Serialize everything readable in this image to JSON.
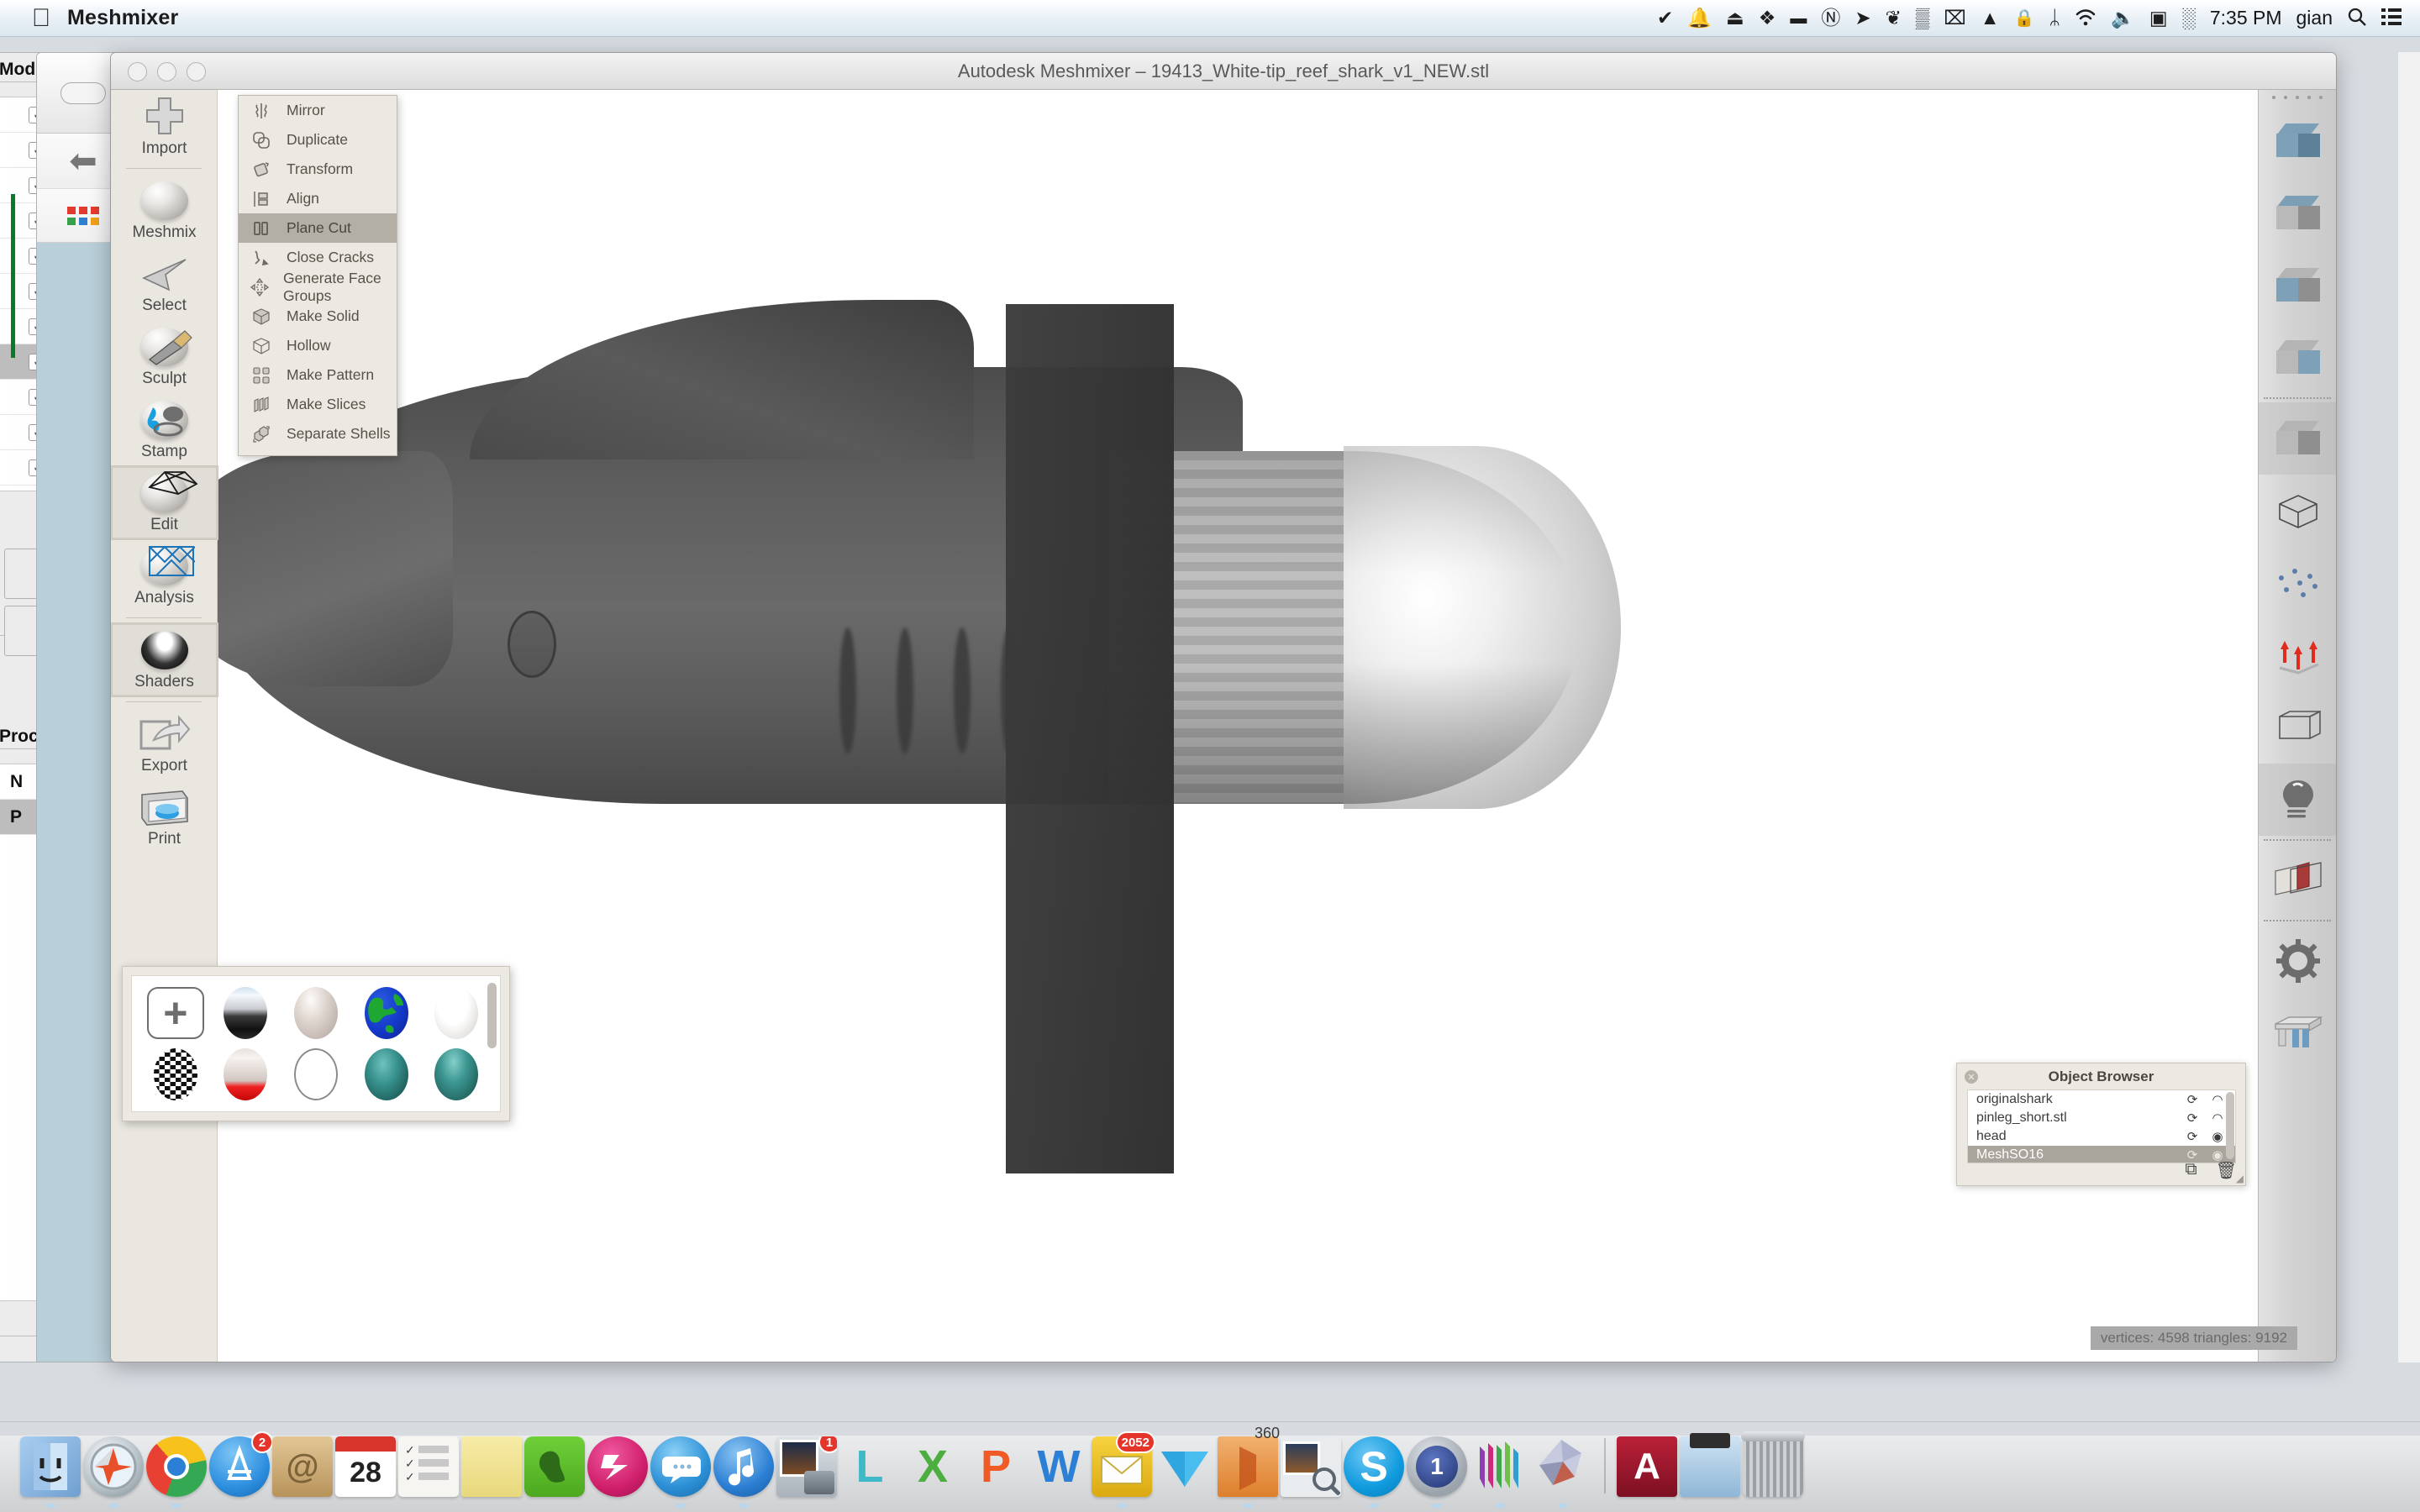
{
  "menubar": {
    "apple_icon": "apple-logo-icon",
    "app_name": "Meshmixer",
    "clock": "7:35 PM",
    "user": "gian",
    "status_icons": [
      {
        "name": "checkmark-badge-icon",
        "glyph": "✔"
      },
      {
        "name": "bell-icon",
        "glyph": "🔔"
      },
      {
        "name": "eject-box-icon",
        "glyph": "⏏"
      },
      {
        "name": "dropbox-icon",
        "glyph": "❖"
      },
      {
        "name": "battery-menu-icon",
        "glyph": "▬"
      },
      {
        "name": "alfred-icon",
        "glyph": "Ⓝ"
      },
      {
        "name": "transmit-icon",
        "glyph": "➤"
      },
      {
        "name": "evernote-icon",
        "glyph": "❦"
      },
      {
        "name": "grid-panels-icon",
        "glyph": "▒"
      },
      {
        "name": "shield-x-icon",
        "glyph": "⌧"
      },
      {
        "name": "airplay-icon",
        "glyph": "▲"
      },
      {
        "name": "lock-icon",
        "glyph": "🔒"
      },
      {
        "name": "bluetooth-icon",
        "glyph": "ᛦ"
      },
      {
        "name": "wifi-icon",
        "glyph": "◠"
      },
      {
        "name": "volume-icon",
        "glyph": "🔈"
      },
      {
        "name": "display-icon",
        "glyph": "▣"
      },
      {
        "name": "remote-icon",
        "glyph": "░"
      }
    ],
    "search_icon": "search-icon",
    "list-icon": "notification-center-icon"
  },
  "window": {
    "title": "Autodesk Meshmixer – 19413_White-tip_reef_shark_v1_NEW.stl",
    "traffic_lights": [
      "close-button",
      "minimize-button",
      "zoom-button"
    ]
  },
  "toolrail": {
    "items": [
      {
        "label": "Import",
        "icon": "plus-icon",
        "active": false
      },
      {
        "label": "Meshmix",
        "icon": "face-sphere-icon",
        "active": false
      },
      {
        "label": "Select",
        "icon": "cursor-arrow-icon",
        "active": false
      },
      {
        "label": "Sculpt",
        "icon": "brush-sphere-icon",
        "active": false
      },
      {
        "label": "Stamp",
        "icon": "stamp-sphere-icon",
        "active": false
      },
      {
        "label": "Edit",
        "icon": "wireframe-sphere-icon",
        "active": true
      },
      {
        "label": "Analysis",
        "icon": "mesh-analysis-icon",
        "active": false
      },
      {
        "label": "Shaders",
        "icon": "shiny-sphere-icon",
        "active": true
      },
      {
        "label": "Export",
        "icon": "export-arrow-icon",
        "active": false
      },
      {
        "label": "Print",
        "icon": "printer-icon",
        "active": false
      }
    ]
  },
  "edit_menu": {
    "items": [
      {
        "label": "Mirror",
        "icon": "mirror-icon",
        "glyph": "⌇",
        "highlighted": false
      },
      {
        "label": "Duplicate",
        "icon": "duplicate-icon",
        "glyph": "⧉",
        "highlighted": false
      },
      {
        "label": "Transform",
        "icon": "transform-icon",
        "glyph": "◇",
        "highlighted": false
      },
      {
        "label": "Align",
        "icon": "align-icon",
        "glyph": "▤",
        "highlighted": false
      },
      {
        "label": "Plane Cut",
        "icon": "plane-cut-icon",
        "glyph": "‖",
        "highlighted": true
      },
      {
        "label": "Close Cracks",
        "icon": "close-cracks-icon",
        "glyph": "⤳",
        "highlighted": false
      },
      {
        "label": "Generate Face Groups",
        "icon": "face-groups-icon",
        "glyph": "✤",
        "highlighted": false
      },
      {
        "label": "Make Solid",
        "icon": "solid-cube-icon",
        "glyph": "⬛",
        "highlighted": false
      },
      {
        "label": "Hollow",
        "icon": "hollow-cube-icon",
        "glyph": "⬡",
        "highlighted": false
      },
      {
        "label": "Make Pattern",
        "icon": "pattern-grid-icon",
        "glyph": "▒",
        "highlighted": false
      },
      {
        "label": "Make Slices",
        "icon": "slices-icon",
        "glyph": "▒",
        "highlighted": false
      },
      {
        "label": "Separate Shells",
        "icon": "separate-shells-icon",
        "glyph": "❐",
        "highlighted": false
      }
    ]
  },
  "shader_palette": {
    "add_button_icon": "add-shader-plus-icon",
    "swatches": [
      {
        "name": "shader-add",
        "label": "+"
      },
      {
        "name": "shader-blue-black-gradient",
        "color": "#3b3b3b"
      },
      {
        "name": "shader-neutral-clay",
        "color": "#cfc6c0"
      },
      {
        "name": "shader-earth-globe",
        "color": "#1438c8"
      },
      {
        "name": "shader-white-gloss",
        "color": "#f2f0ee"
      },
      {
        "name": "shader-checkerboard",
        "color": "#111111"
      },
      {
        "name": "shader-red-gradient",
        "color": "#e81010"
      },
      {
        "name": "shader-outline-only",
        "color": "#ffffff"
      },
      {
        "name": "shader-teal-matte",
        "color": "#2e7a78"
      },
      {
        "name": "shader-teal-gloss",
        "color": "#2f7f7d"
      }
    ]
  },
  "object_browser": {
    "title": "Object Browser",
    "close_icon": "close-icon",
    "rows": [
      {
        "name": "originalshark",
        "pin_icon": "pin-icon",
        "visibility_icon": "eye-closed-icon",
        "selected": false
      },
      {
        "name": "pinleg_short.stl",
        "pin_icon": "pin-icon",
        "visibility_icon": "eye-closed-icon",
        "selected": false
      },
      {
        "name": "head",
        "pin_icon": "pin-icon",
        "visibility_icon": "eye-open-icon",
        "selected": false
      },
      {
        "name": "MeshSO16",
        "pin_icon": "pin-icon",
        "visibility_icon": "eye-open-icon",
        "selected": true
      }
    ],
    "footer_icons": [
      {
        "name": "duplicate-object-icon",
        "glyph": "⧉"
      },
      {
        "name": "delete-object-icon",
        "glyph": "🗑"
      }
    ],
    "resize_handle_icon": "resize-handle-icon"
  },
  "status": {
    "text": "vertices: 4598 triangles: 9192"
  },
  "right_toolbar": {
    "items": [
      {
        "name": "view-front-icon",
        "style": "all-blue"
      },
      {
        "name": "view-top-icon",
        "style": "top-blue"
      },
      {
        "name": "view-left-icon",
        "style": "left-blue"
      },
      {
        "name": "view-right-icon",
        "style": "right-blue"
      },
      {
        "name": "view-shaded-icon",
        "style": "grey",
        "active": true
      },
      {
        "name": "view-wireframe-icon",
        "style": "wire"
      },
      {
        "name": "view-points-icon",
        "style": "dots"
      },
      {
        "name": "view-normals-icon",
        "style": "arrows"
      },
      {
        "name": "view-boundaries-icon",
        "style": "cube-outline"
      },
      {
        "name": "lighting-icon",
        "style": "bulb",
        "active": true
      },
      {
        "name": "section-plane-icon",
        "style": "red-plane"
      },
      {
        "name": "settings-gear-icon",
        "style": "gear"
      },
      {
        "name": "printer-bed-icon",
        "style": "bed"
      }
    ]
  },
  "background_window": {
    "section_labels": [
      "Models",
      "Processing"
    ],
    "field_labels": [
      "N",
      "P"
    ]
  },
  "dock": {
    "items": [
      {
        "name": "dock-finder",
        "label": "",
        "color": "#8fb6e0",
        "running": true
      },
      {
        "name": "dock-safari",
        "label": "",
        "color": "#b9c4cb",
        "running": true
      },
      {
        "name": "dock-chrome",
        "label": "",
        "color": "#e84133",
        "running": true
      },
      {
        "name": "dock-app-store",
        "label": "",
        "color": "#2e8fe0",
        "badge": "2",
        "running": false
      },
      {
        "name": "dock-contacts",
        "label": "",
        "color": "#c9a877",
        "running": false
      },
      {
        "name": "dock-calendar",
        "label": "28",
        "color": "#ffffff",
        "running": false
      },
      {
        "name": "dock-reminders",
        "label": "",
        "color": "#f4f3ee",
        "running": false
      },
      {
        "name": "dock-stickies",
        "label": "",
        "color": "#f4e9a8",
        "running": false
      },
      {
        "name": "dock-evernote",
        "label": "",
        "color": "#5ec12a",
        "running": false
      },
      {
        "name": "dock-things",
        "label": "",
        "color": "#d01f6b",
        "running": false
      },
      {
        "name": "dock-messages",
        "label": "",
        "color": "#49a3e5",
        "running": true
      },
      {
        "name": "dock-itunes",
        "label": "",
        "color": "#2b7fd4",
        "running": true
      },
      {
        "name": "dock-iphoto",
        "label": "",
        "color": "#9aa4ad",
        "badge": "1",
        "running": false
      },
      {
        "name": "dock-lightroom",
        "label": "L",
        "color": "#3fb9c7",
        "running": false
      },
      {
        "name": "dock-xcode",
        "label": "X",
        "color": "#4cae3f",
        "running": false
      },
      {
        "name": "dock-photoshop",
        "label": "P",
        "color": "#ef5a25",
        "running": false
      },
      {
        "name": "dock-word",
        "label": "W",
        "color": "#2b7fd4",
        "running": false
      },
      {
        "name": "dock-mail",
        "label": "",
        "color": "#f0c218",
        "badge": "2052",
        "running": true
      },
      {
        "name": "dock-dropbox",
        "label": "",
        "color": "#2fb3e8",
        "running": false
      },
      {
        "name": "dock-powerpoint",
        "label": "360",
        "color": "#e08a3c",
        "running": true
      },
      {
        "name": "dock-preview",
        "label": "",
        "color": "#c9d3da",
        "running": false
      },
      {
        "name": "dock-skype",
        "label": "S",
        "color": "#1da1e0",
        "running": true
      },
      {
        "name": "dock-alarm",
        "label": "1",
        "color": "#3a4f9b",
        "running": true
      },
      {
        "name": "dock-numbers",
        "label": "",
        "color": "#6fbf4a",
        "running": true
      },
      {
        "name": "dock-meshmixer",
        "label": "",
        "color": "#b0b4cc",
        "running": true
      },
      {
        "name": "dock-downloads-folder",
        "label": "A",
        "color": "#a31b30",
        "running": false
      },
      {
        "name": "dock-documents-folder",
        "label": "",
        "color": "#a8cbe4",
        "running": false
      },
      {
        "name": "dock-trash",
        "label": "",
        "color": "#b9bcbe",
        "running": false
      }
    ]
  }
}
